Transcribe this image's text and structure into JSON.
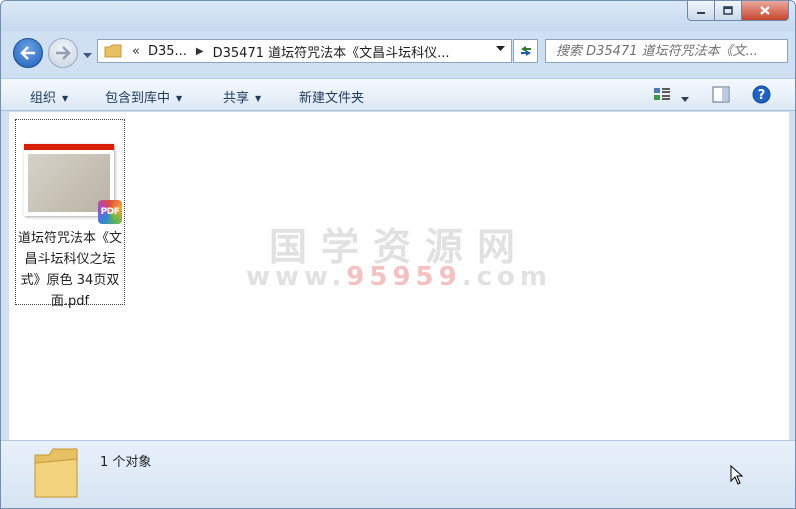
{
  "window": {
    "buttons": {
      "minimize": "minimize",
      "maximize": "maximize",
      "close": "close"
    }
  },
  "nav": {
    "address": {
      "overflow": "«",
      "crumbs": [
        "D35...",
        "D35471 道坛符咒法本《文昌斗坛科仪..."
      ]
    },
    "search": {
      "placeholder": "搜索 D35471 道坛符咒法本《文..."
    }
  },
  "toolbar": {
    "organize": "组织",
    "include_in_library": "包含到库中",
    "share": "共享",
    "new_folder": "新建文件夹"
  },
  "files": [
    {
      "name": "道坛符咒法本《文昌斗坛科仪之坛式》原色 34页双面.pdf",
      "badge": "PDF"
    }
  ],
  "watermark": {
    "title": "国学资源网",
    "url_prefix": "www.",
    "url_number": "95959",
    "url_suffix": ".com"
  },
  "status": {
    "count": "1 个对象"
  },
  "colors": {
    "accent": "#1f5fb8",
    "pdf_red": "#d81e06",
    "toolbar_text": "#1e3b5e"
  }
}
